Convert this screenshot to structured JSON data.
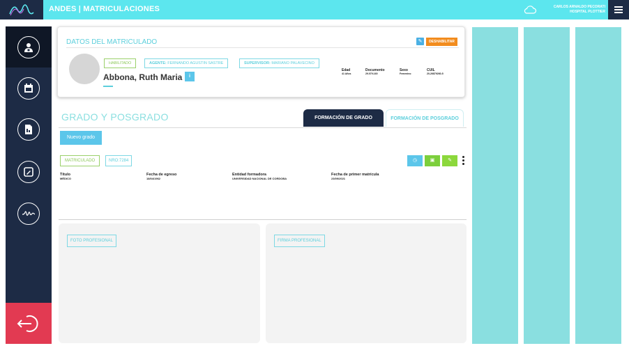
{
  "header": {
    "app_title": "ANDES | MATRICULACIONES",
    "user_name": "CARLOS ARNALDO PECORATI",
    "user_org": "HOSPITAL PLOTTIER"
  },
  "sidebar": {
    "items": [
      {
        "icon": "user-badge-icon"
      },
      {
        "icon": "calendar-icon"
      },
      {
        "icon": "document-icon"
      },
      {
        "icon": "edit-icon"
      },
      {
        "icon": "pulse-icon"
      }
    ],
    "logout_icon": "logout-icon"
  },
  "profile": {
    "card_title": "DATOS DEL MATRICULADO",
    "disable_label": "DESHABILITAR",
    "status": "HABILITADO",
    "agente_label": "AGENTE:",
    "agente": "FERNANDO AGUSTIN SASTRE",
    "supervisor_label": "SUPERVISOR:",
    "supervisor": "MARIANO PALAVECINO",
    "name": "Abbona, Ruth Maria",
    "info_icon": "i",
    "edad_label": "Edad",
    "edad": "41 Años",
    "documento_label": "Documento",
    "documento": "29.079.160",
    "sexo_label": "Sexo",
    "sexo": "Femenino",
    "cuil_label": "CUIL",
    "cuil": "20-26879260-5"
  },
  "grado": {
    "section_title": "GRADO Y POSGRADO",
    "tab_grado": "FORMACIÓN DE GRADO",
    "tab_posgrado": "FORMACIÓN DE POSGRADO",
    "new_button": "Nuevo grado",
    "status_tag": "MATRICULADO",
    "nro_tag": "NRO:7284",
    "fields": [
      {
        "label": "Título",
        "value": "MÉDICO"
      },
      {
        "label": "Fecha de egreso",
        "value": "18/04/1962"
      },
      {
        "label": "Entidad formadora",
        "value": "UNIVERSIDAD NACIONAL DE CORDOBA"
      },
      {
        "label": "Fecha de primer matrícula",
        "value": "23/09/2021"
      }
    ]
  },
  "panels": {
    "foto": "FOTO PROFESIONAL",
    "firma": "FIRMA PROFESIONAL"
  },
  "colors": {
    "topbar": "#5ce6ee",
    "navy": "#1d2b45",
    "logout": "#e23a52",
    "accent": "#5ccfdc",
    "green": "#8cc858",
    "orange": "#f28c1e"
  }
}
